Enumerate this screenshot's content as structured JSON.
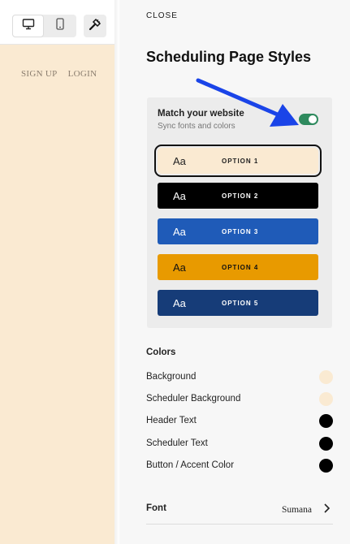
{
  "preview": {
    "nav": {
      "signup": "SIGN UP",
      "login": "LOGIN"
    },
    "background_color": "#faead2"
  },
  "toolbar": {
    "desktop_icon": "desktop-icon",
    "mobile_icon": "mobile-icon",
    "brush_icon": "paintbrush-icon"
  },
  "panel": {
    "close_label": "CLOSE",
    "title": "Scheduling Page Styles",
    "match": {
      "title": "Match your website",
      "subtitle": "Sync fonts and colors",
      "toggle_on": true
    },
    "options": [
      {
        "aa": "Aa",
        "label": "OPTION 1",
        "bg": "#faead2",
        "fg": "#222222",
        "selected": true
      },
      {
        "aa": "Aa",
        "label": "OPTION 2",
        "bg": "#000000",
        "fg": "#ffffff",
        "selected": false
      },
      {
        "aa": "Aa",
        "label": "OPTION 3",
        "bg": "#1f5bb8",
        "fg": "#ffffff",
        "selected": false
      },
      {
        "aa": "Aa",
        "label": "OPTION 4",
        "bg": "#e89a00",
        "fg": "#111111",
        "selected": false
      },
      {
        "aa": "Aa",
        "label": "OPTION 5",
        "bg": "#163c78",
        "fg": "#ffffff",
        "selected": false
      }
    ],
    "colors_title": "Colors",
    "colors": [
      {
        "name": "Background",
        "swatch": "#faead2"
      },
      {
        "name": "Scheduler Background",
        "swatch": "#faead2"
      },
      {
        "name": "Header Text",
        "swatch": "#000000"
      },
      {
        "name": "Scheduler Text",
        "swatch": "#000000"
      },
      {
        "name": "Button / Accent Color",
        "swatch": "#000000"
      }
    ],
    "font": {
      "label": "Font",
      "value": "Sumana"
    }
  },
  "annotation": {
    "arrow_color": "#1a44e8"
  }
}
